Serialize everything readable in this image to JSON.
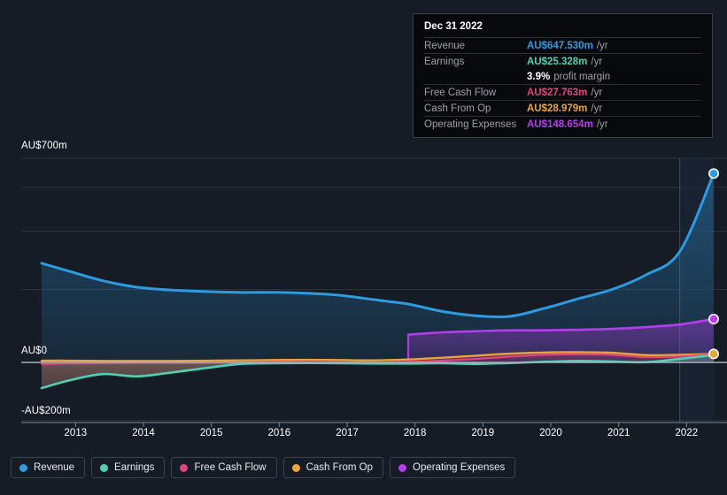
{
  "colors": {
    "background": "#151c26",
    "revenue": "#2e9ae0",
    "earnings": "#4fd1b0",
    "free_cash_flow": "#e0457b",
    "cash_from_op": "#e8a33d",
    "operating_expenses": "#b43dee",
    "gridline": "#2a3340",
    "axis_label": "#ffffff"
  },
  "tooltip": {
    "date": "Dec 31 2022",
    "rows": [
      {
        "key": "Revenue",
        "value": "AU$647.530m",
        "suffix": "/yr",
        "color": "#2e9ae0"
      },
      {
        "key": "Earnings",
        "value": "AU$25.328m",
        "suffix": "/yr",
        "color": "#4fd1b0"
      },
      {
        "key": "",
        "value": "3.9%",
        "suffix": "profit margin",
        "color": "#ffffff"
      },
      {
        "key": "Free Cash Flow",
        "value": "AU$27.763m",
        "suffix": "/yr",
        "color": "#e0457b"
      },
      {
        "key": "Cash From Op",
        "value": "AU$28.979m",
        "suffix": "/yr",
        "color": "#e8a33d"
      },
      {
        "key": "Operating Expenses",
        "value": "AU$148.654m",
        "suffix": "/yr",
        "color": "#b43dee"
      }
    ]
  },
  "legend": {
    "items": [
      {
        "label": "Revenue",
        "color": "#2e9ae0"
      },
      {
        "label": "Earnings",
        "color": "#4fd1b0"
      },
      {
        "label": "Free Cash Flow",
        "color": "#e0457b"
      },
      {
        "label": "Cash From Op",
        "color": "#e8a33d"
      },
      {
        "label": "Operating Expenses",
        "color": "#b43dee"
      }
    ]
  },
  "chart_data": {
    "type": "area",
    "title": "",
    "xlabel": "",
    "ylabel": "",
    "currency": "AU$",
    "unit": "m",
    "grid": true,
    "legend_position": "bottom",
    "ylim": [
      -200,
      700
    ],
    "ytick_labels": [
      "AU$700m",
      "AU$0",
      "-AU$200m"
    ],
    "yticks": [
      700,
      0,
      -200
    ],
    "gridline_values": [
      700,
      600,
      450,
      250,
      0,
      -200
    ],
    "xtick_labels": [
      "2013",
      "2014",
      "2015",
      "2016",
      "2017",
      "2018",
      "2019",
      "2020",
      "2021",
      "2022"
    ],
    "x": [
      2012.6,
      2013,
      2013.5,
      2014,
      2014.5,
      2015,
      2015.5,
      2016,
      2016.5,
      2017,
      2017.5,
      2018,
      2018.5,
      2019,
      2019.5,
      2020,
      2020.5,
      2021,
      2021.5,
      2022,
      2022.5
    ],
    "highlight_range": [
      2022.0,
      2022.5
    ],
    "series": [
      {
        "name": "Revenue",
        "color": "#2e9ae0",
        "values": [
          340,
          313,
          280,
          258,
          248,
          243,
          240,
          240,
          237,
          230,
          215,
          200,
          175,
          160,
          158,
          185,
          218,
          250,
          300,
          380,
          647.53
        ]
      },
      {
        "name": "Earnings",
        "color": "#4fd1b0",
        "values": [
          -88,
          -62,
          -40,
          -48,
          -35,
          -20,
          -6,
          -3,
          -2,
          -3,
          -4,
          -4,
          -3,
          -5,
          -2,
          2,
          5,
          3,
          1,
          12,
          25.328
        ]
      },
      {
        "name": "Free Cash Flow",
        "color": "#e0457b",
        "values": [
          -6,
          -4,
          -3,
          -2,
          -2,
          -2,
          0,
          1,
          1,
          0,
          -1,
          2,
          6,
          12,
          20,
          26,
          28,
          26,
          18,
          20,
          27.763
        ]
      },
      {
        "name": "Cash From Op",
        "color": "#e8a33d",
        "values": [
          6,
          6,
          5,
          5,
          5,
          6,
          7,
          8,
          9,
          8,
          7,
          10,
          16,
          23,
          30,
          34,
          35,
          33,
          25,
          26,
          28.979
        ]
      },
      {
        "name": "Operating Expenses",
        "color": "#b43dee",
        "start_x": 2018,
        "values": [
          null,
          null,
          null,
          null,
          null,
          null,
          null,
          null,
          null,
          null,
          null,
          95,
          103,
          107,
          110,
          110,
          112,
          115,
          121,
          130,
          148.654
        ]
      }
    ],
    "endpoints": [
      {
        "series": "Revenue",
        "value": 647.53,
        "color": "#2e9ae0"
      },
      {
        "series": "Operating Expenses",
        "value": 148.654,
        "color": "#b43dee"
      },
      {
        "series": "Cash From Op",
        "value": 28.979,
        "color": "#e8a33d"
      }
    ]
  }
}
